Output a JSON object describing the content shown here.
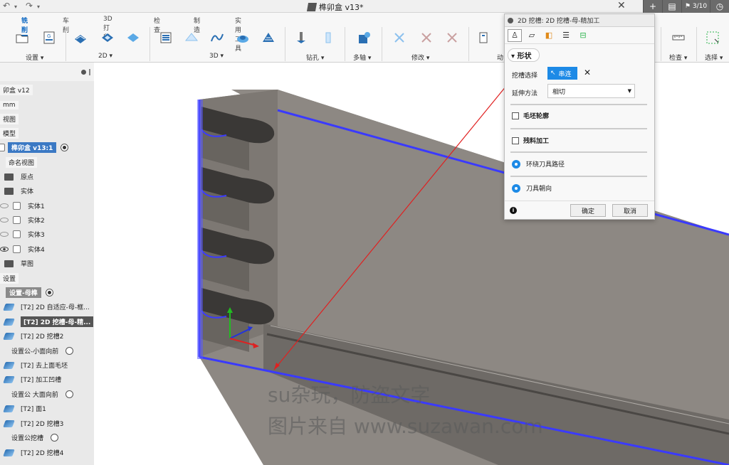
{
  "titlebar": {
    "doc_title": "榫卯盒 v13*",
    "version_badge": "3/10",
    "undo_icon": "undo-icon",
    "redo_icon": "redo-icon"
  },
  "toolbar": {
    "tabs": [
      "铣削",
      "车削",
      "3D 打印",
      "检查",
      "制造",
      "实用工具"
    ],
    "active_tab": "铣削",
    "groups": {
      "setup": "设置 ▾",
      "two_d": "2D ▾",
      "three_d": "3D ▾",
      "drilling": "钻孔 ▾",
      "multi_axis": "多轴 ▾",
      "modify": "修改 ▾",
      "action": "动",
      "inspect": "检查 ▾",
      "select": "选择 ▾"
    }
  },
  "browser": {
    "nodes": [
      {
        "label": "卯盒 v12"
      },
      {
        "label": "mm"
      },
      {
        "label": "视图"
      },
      {
        "label": "模型"
      },
      {
        "label": "榫卯盒 v13:1"
      },
      {
        "label": "命名视图"
      },
      {
        "label": "原点"
      },
      {
        "label": "实体"
      },
      {
        "label": "实体1"
      },
      {
        "label": "实体2"
      },
      {
        "label": "实体3"
      },
      {
        "label": "实体4"
      },
      {
        "label": "草图"
      },
      {
        "label": "设置"
      },
      {
        "label": "设置-母榫"
      },
      {
        "label": "[T2] 2D 自适应-母-框..."
      },
      {
        "label": "[T2] 2D 挖槽-母-精..."
      },
      {
        "label": "[T2] 2D 挖槽2"
      },
      {
        "label": "设置公-小面向前"
      },
      {
        "label": "[T2] 去上面毛坯"
      },
      {
        "label": "[T2] 加工凹槽"
      },
      {
        "label": "设置公 大面向前"
      },
      {
        "label": "[T2] 面1"
      },
      {
        "label": "[T2] 2D 挖槽3"
      },
      {
        "label": "设置公挖槽"
      },
      {
        "label": "[T2] 2D 挖槽4"
      }
    ]
  },
  "dialog": {
    "title": "2D 挖槽: 2D 挖槽-母-精加工",
    "section": "形状",
    "pocket_select_label": "挖槽选择",
    "chain_button": "串连",
    "extend_label": "延伸方法",
    "extend_value": "相切",
    "stock_contours": "毛坯轮廓",
    "rest_machining": "残料加工",
    "closed_paths": "环绕刀具路径",
    "tool_orientation": "刀具朝向",
    "ok": "确定",
    "cancel": "取消"
  },
  "watermark": {
    "line1": "su杂玩，防盗文字",
    "line2": "图片来自 www.suzawan.com"
  },
  "colors": {
    "accent": "#1d8ae6",
    "selection_edge": "#3a3aff",
    "model_gray": "#8a8580"
  }
}
